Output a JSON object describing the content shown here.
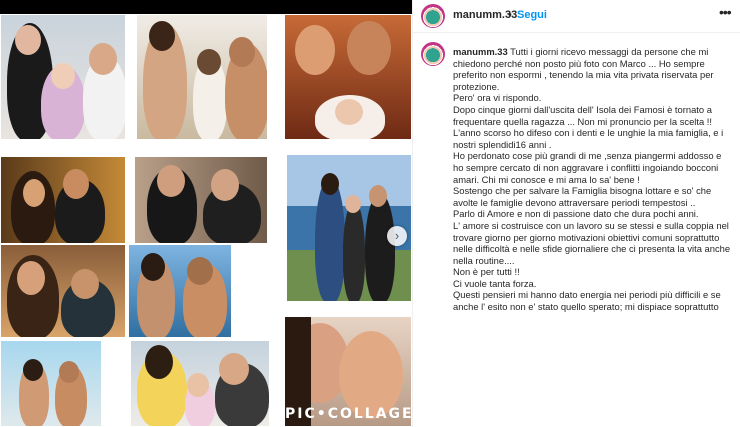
{
  "post": {
    "username": "manumm.33",
    "separator": "•",
    "follow_label": "Segui",
    "more_icon": "more-horizontal-icon",
    "collage_label": "PIC•COLLAGE",
    "carousel_icon": "chevron-right-icon"
  },
  "caption": {
    "username": "manumm.33",
    "lines": [
      "Tutti i giorni ricevo messaggi da persone che mi chiedono perché non posto più foto con Marco ... Ho sempre preferito non espormi , tenendo la mia vita privata riservata per protezione.",
      "Pero' ora vi rispondo.",
      "Dopo cinque giorni dall'uscita dell' Isola dei Famosi è tornato a frequentare quella ragazza ... Non mi pronuncio per la scelta !!",
      "L'anno scorso ho difeso con i denti e le unghie la mia famiglia, e i nostri splendidi16 anni .",
      "Ho perdonato cose più grandi di me ,senza piangermi addosso e ho sempre cercato di non aggravare i conflitti ingoiando bocconi amari. Chi mi conosce e mi ama lo sa' bene !",
      "Sostengo che per salvare la Famiglia bisogna lottare e so' che avolte le famiglie devono attraversare periodi tempestosi ..",
      "Parlo di Amore e non di passione dato che dura pochi anni.",
      "L' amore si costruisce con un lavoro su se stessi e sulla coppia nel trovare giorno per giorno motivazioni obiettivi comuni soprattutto nelle difficoltà e nelle sfide giornaliere che ci presenta la vita anche nella routine....",
      "Non è per tutti !!",
      "Ci vuole tanta forza.",
      "Questi pensieri mi hanno dato energia nei periodi più difficili e se anche l' esito non e' stato quello sperato; mi dispiace soprattutto"
    ]
  }
}
